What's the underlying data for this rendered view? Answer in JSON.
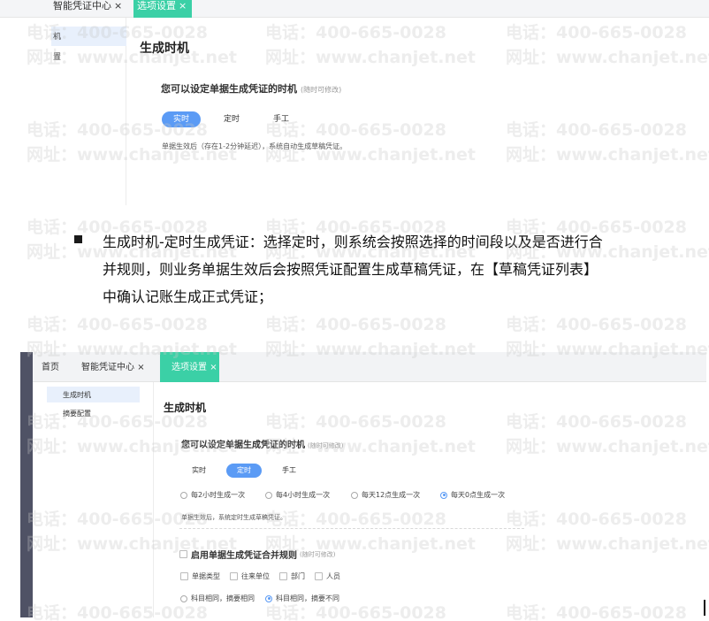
{
  "top_screenshot": {
    "tabs": [
      {
        "label": "智能凭证中心",
        "close": "×"
      },
      {
        "label": "选项设置",
        "close": "×"
      }
    ],
    "sidebar_fragments": [
      "机",
      "置"
    ],
    "section_title": "生成时机",
    "question": "您可以设定单据生成凭证的时机",
    "question_note": "(随时可修改)",
    "modes": [
      "实时",
      "定时",
      "手工"
    ],
    "selected_mode": "实时",
    "description": "单据生效后（存在1-2分钟延迟），系统自动生成草稿凭证。"
  },
  "paragraph": {
    "lines": [
      "生成时机-定时生成凭证：选择定时，则系统会按照选择的时间段以及是否进行合",
      "并规则，则业务单据生效后会按照凭证配置生成草稿凭证，在【草稿凭证列表】",
      "中确认记账生成正式凭证；"
    ]
  },
  "bottom_screenshot": {
    "tabs": [
      {
        "label": "首页"
      },
      {
        "label": "智能凭证中心",
        "close": "×"
      },
      {
        "label": "选项设置",
        "close": "×"
      }
    ],
    "sidebar": [
      "生成时机",
      "摘要配置"
    ],
    "section_title": "生成时机",
    "question": "您可以设定单据生成凭证的时机",
    "question_note": "(随时可修改)",
    "modes": [
      "实时",
      "定时",
      "手工"
    ],
    "selected_mode": "定时",
    "schedule_options": [
      "每2小时生成一次",
      "每4小时生成一次",
      "每天12点生成一次",
      "每天0点生成一次"
    ],
    "selected_schedule": "每天0点生成一次",
    "description": "单据生效后，系统定时生成草稿凭证。",
    "merge_rule_label": "启用单据生成凭证合并规则",
    "merge_rule_note": "(随时可修改)",
    "merge_fields": [
      "单据类型",
      "往来单位",
      "部门",
      "人员"
    ],
    "summary_options": [
      "科目相同，摘要相同",
      "科目相同，摘要不同"
    ],
    "selected_summary": "科目相同，摘要不同"
  },
  "watermark": {
    "phone": "电话：400-665-0028",
    "site": "网址：www.chanjet.net"
  },
  "colors": {
    "accent_green": "#3bd0a6",
    "accent_blue": "#5b9bf5",
    "sidebar_dark": "#4f5265",
    "highlight": "#e8f0fc"
  }
}
